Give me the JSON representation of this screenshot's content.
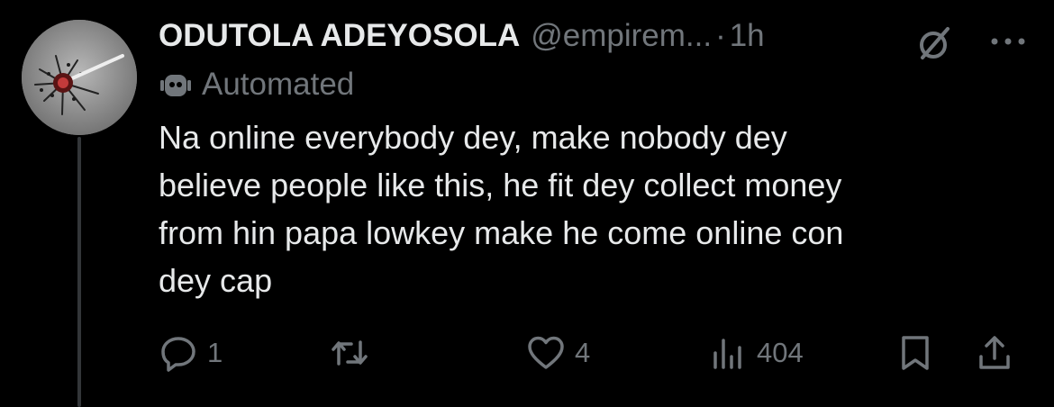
{
  "post": {
    "author_name": "ODUTOLA ADEYOSOLA",
    "handle": "@empirem...",
    "separator": "·",
    "time": "1h",
    "label": "Automated",
    "text": "Na online everybody dey, make nobody dey\nbelieve people like this, he fit dey collect money\nfrom hin papa lowkey make he come online con\ndey cap"
  },
  "actions": {
    "reply_count": "1",
    "repost_count": "",
    "like_count": "4",
    "views_count": "404"
  },
  "icons": {
    "avatar": "avatar-image",
    "header": [
      "grok-icon",
      "more-icon"
    ],
    "label": "bot-icon",
    "actions": [
      "reply-icon",
      "repost-icon",
      "like-icon",
      "views-icon",
      "bookmark-icon",
      "share-icon"
    ]
  },
  "colors": {
    "background": "#000000",
    "primary_text": "#e7e9ea",
    "secondary_text": "#71767b",
    "thread_line": "#333639"
  }
}
